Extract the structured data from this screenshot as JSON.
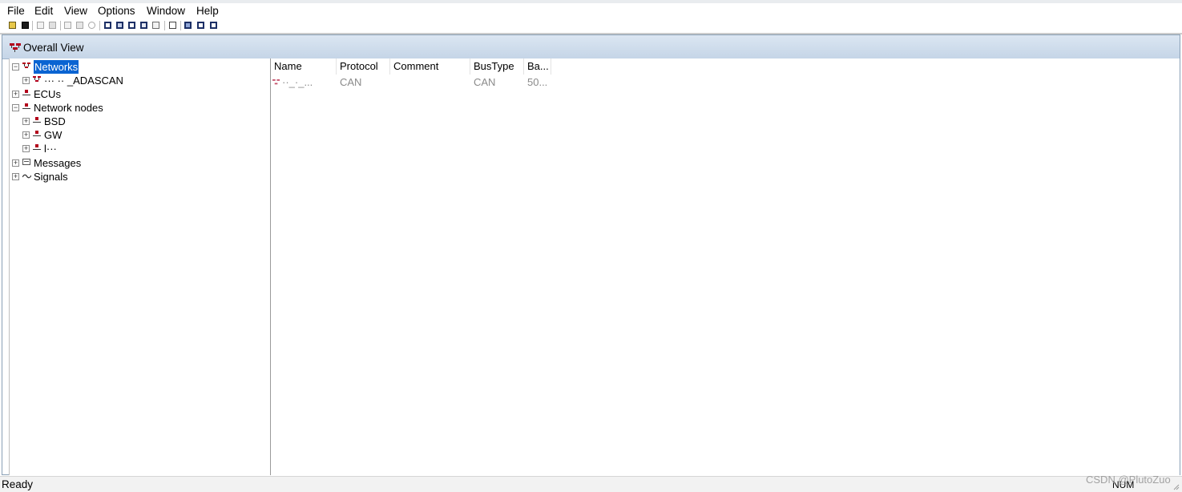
{
  "menu": [
    "File",
    "Edit",
    "View",
    "Options",
    "Window",
    "Help"
  ],
  "toolbar_icons": [
    "open-folder-icon",
    "save-icon",
    "copy-icon",
    "paste-icon",
    "new-item-icon",
    "delete-icon",
    "find-icon",
    "view-overall-icon",
    "view-list-icon",
    "view-table-icon",
    "view-detail-icon",
    "view-form-icon",
    "hex-icon",
    "cascade-icon",
    "tile-horizontal-icon",
    "tile-vertical-icon"
  ],
  "window": {
    "title": "Overall View"
  },
  "tree": {
    "networks": {
      "label": "Networks",
      "children": [
        "··· ·· _ADASCAN"
      ]
    },
    "ecus": "ECUs",
    "network_nodes": {
      "label": "Network nodes",
      "children": [
        "BSD",
        "GW",
        "l···"
      ]
    },
    "messages": "Messages",
    "signals": "Signals"
  },
  "list": {
    "columns": [
      "Name",
      "Protocol",
      "Comment",
      "BusType",
      "Ba..."
    ],
    "rows": [
      {
        "name": "··_·_...",
        "protocol": "CAN",
        "comment": "",
        "bustype": "CAN",
        "baudrate": "50..."
      }
    ]
  },
  "status": {
    "text": "Ready",
    "num": "NUM",
    "watermark": "CSDN @PlutoZuo"
  },
  "colors": {
    "selection": "#0a64d2",
    "network_icon": "#b3001b",
    "title_bar": "#c5d5e7"
  }
}
